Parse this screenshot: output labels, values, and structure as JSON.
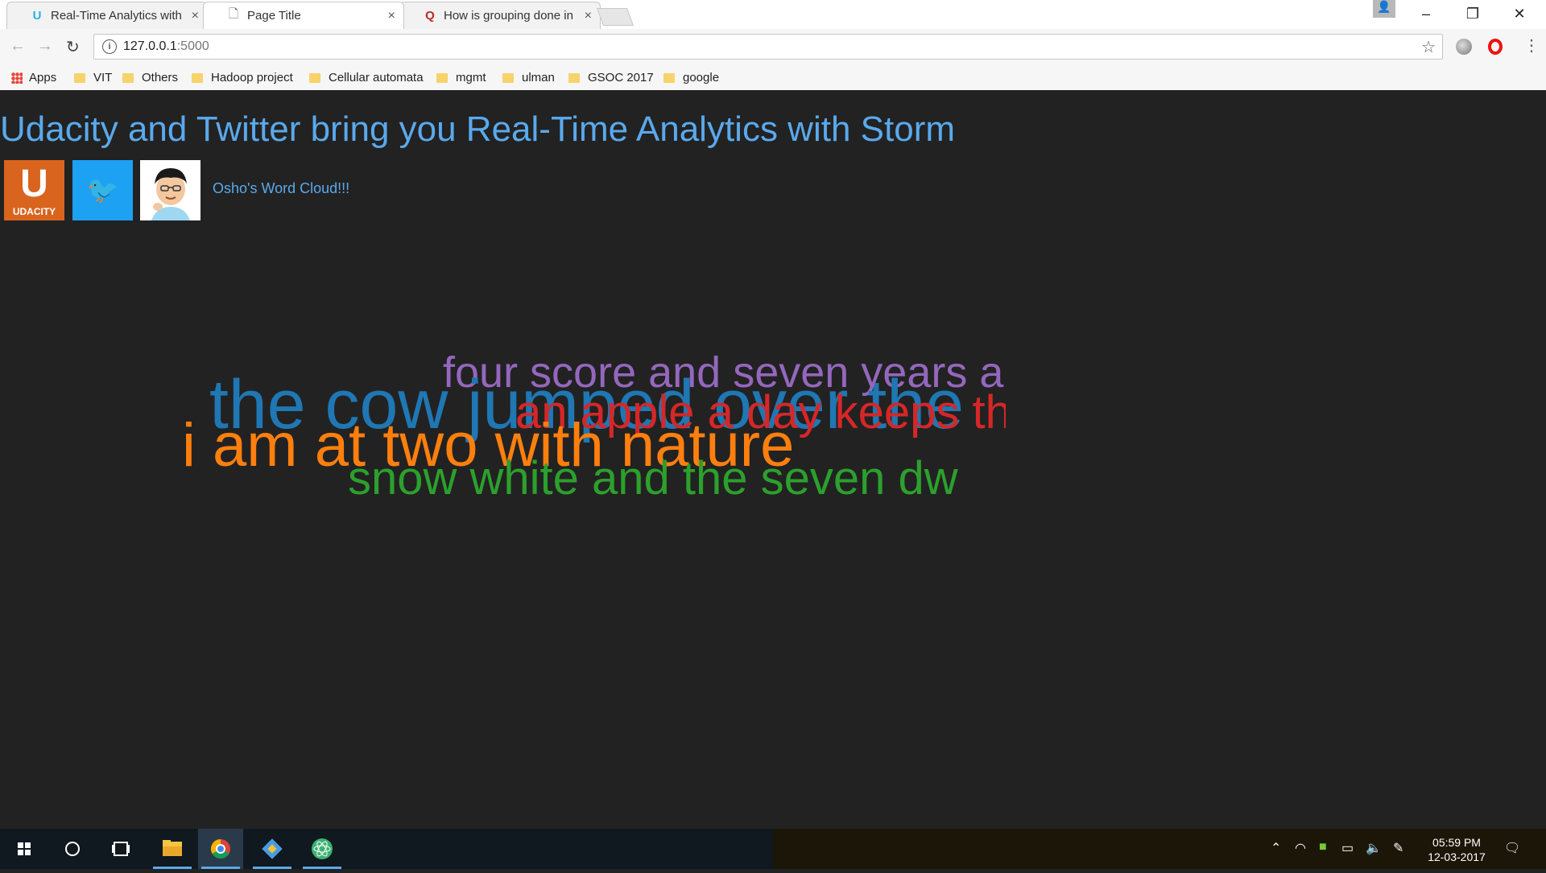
{
  "browser": {
    "tabs": [
      {
        "label": "Real-Time Analytics with",
        "icon": "udacity-favicon-icon",
        "active": false
      },
      {
        "label": "Page Title",
        "icon": "page-icon",
        "active": true
      },
      {
        "label": "How is grouping done in",
        "icon": "quora-favicon-icon",
        "active": false
      }
    ],
    "tab_close": "×",
    "url_host": "127.0.0.1",
    "url_port": ":5000",
    "bookmarks": [
      "Apps",
      "VIT",
      "Others",
      "Hadoop project",
      "Cellular automata",
      "mgmt",
      "ulman",
      "GSOC 2017",
      "google"
    ]
  },
  "page": {
    "title": "Udacity and Twitter bring you Real-Time Analytics with Storm",
    "udacity_logo_text": "UDACITY",
    "udacity_logo_letter": "U",
    "cloud_link": "Osho's Word Cloud!!!",
    "word_cloud": [
      {
        "text": "four score and seven years a",
        "color": "#9467bd"
      },
      {
        "text": "the cow jumped over the",
        "color": "#1f77b4"
      },
      {
        "text": "an apple a day keeps th",
        "color": "#d62728"
      },
      {
        "text": "i am at two with nature",
        "color": "#ff7f0e"
      },
      {
        "text": "snow white and the seven dw",
        "color": "#2ca02c"
      }
    ]
  },
  "taskbar": {
    "time": "05:59 PM",
    "date": "12-03-2017",
    "accent": "#5aa9ec"
  }
}
